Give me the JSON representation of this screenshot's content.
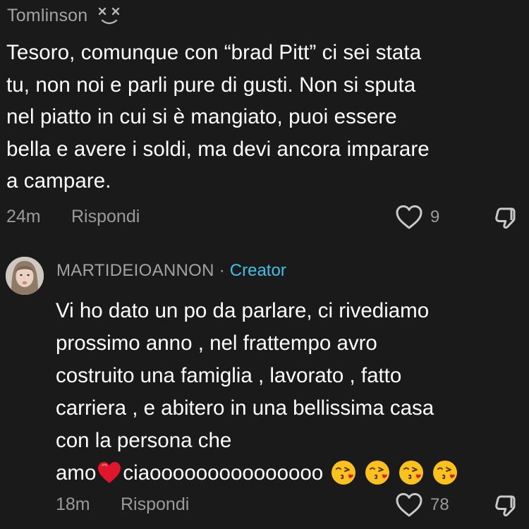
{
  "comment": {
    "username": "Tomlinson",
    "username_emoji": "dizzy-face-emoji",
    "text": "Tesoro, comunque con “brad Pitt” ci sei stata\ntu, non noi e parli pure di gusti. Non si sputa\nnel piatto in cui si è mangiato, puoi essere\nbella e avere i soldi, ma devi ancora imparare\na campare.",
    "time": "24m",
    "reply_label": "Rispondi",
    "likes": "9"
  },
  "reply": {
    "username": "MARTIDEIOANNON",
    "separator": "·",
    "badge": "Creator",
    "text_lines": [
      "Vi ho dato un po da parlare, ci rivediamo",
      "prossimo anno , nel frattempo avro",
      "costruito una famiglia , lavorato , fatto",
      "carriera , e abitero in una bellissima casa",
      "con la persona che"
    ],
    "last_line_start": "amo",
    "last_line_mid": "ciaooooooooooooooo",
    "emojis": [
      "red-heart-emoji",
      "kissing-face-emoji",
      "kissing-face-emoji",
      "kissing-face-emoji",
      "kissing-face-emoji"
    ],
    "time": "18m",
    "reply_label": "Rispondi",
    "likes": "78"
  },
  "colors": {
    "background": "#1a1a1a",
    "primary_text": "#ffffff",
    "secondary_text": "#9a9a9a",
    "creator_badge": "#3ec1e6",
    "heart": "#e0162b"
  }
}
